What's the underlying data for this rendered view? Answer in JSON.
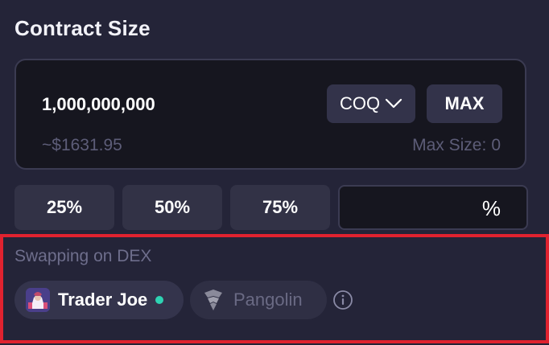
{
  "section": {
    "title": "Contract Size"
  },
  "amount": {
    "value": "1,000,000,000",
    "usd_estimate": "~$1631.95"
  },
  "token_selector": {
    "label": "COQ",
    "icon": "chevron-down-icon"
  },
  "max_button": {
    "label": "MAX"
  },
  "max_size": {
    "label": "Max Size:",
    "value": "0"
  },
  "percent_buttons": [
    {
      "label": "25%"
    },
    {
      "label": "50%"
    },
    {
      "label": "75%"
    }
  ],
  "custom_percent": {
    "value": "",
    "symbol": "%"
  },
  "dex": {
    "label": "Swapping on DEX",
    "options": [
      {
        "name": "Trader Joe",
        "icon": "trader-joe-logo-icon",
        "active": true
      },
      {
        "name": "Pangolin",
        "icon": "pangolin-logo-icon",
        "active": false
      }
    ],
    "info_icon": "info-icon"
  },
  "colors": {
    "background": "#242438",
    "panel": "#16161f",
    "button": "#323246",
    "muted_text": "#5d5d78",
    "active_dot": "#2ed3b3",
    "highlight_border": "#e0222f"
  }
}
